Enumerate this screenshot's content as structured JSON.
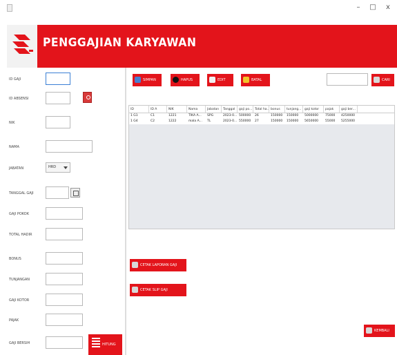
{
  "window": {
    "minimize_glyph": "–",
    "maximize_glyph": "□",
    "close_glyph": "x"
  },
  "banner": {
    "title": "PENGGAJIAN KARYAWAN",
    "logo_icon": "company-logo"
  },
  "form": {
    "labels": {
      "id_gaji": "ID GAJI",
      "id_absensi": "ID ABSENSI",
      "nik": "NIK",
      "nama": "NAMA",
      "jabatan": "JABATAN",
      "tanggal_gaji": "TANGGAL GAJI",
      "gaji_pokok": "GAJI POKOK",
      "total_hadir": "TOTAL HADIR",
      "bonus": "BONUS",
      "tunjangan": "TUNJANGAN",
      "gaji_kotor": "GAJI KOTOR",
      "pajak": "PAJAK",
      "gaji_bersih": "GAJI BERSIH"
    },
    "jabatan_selected": "HRD",
    "hitung_label": "HITUNG"
  },
  "toolbar": {
    "simpan": "SIMPAN",
    "hapus": "HAPUS",
    "edit": "EDIT",
    "batal": "BATAL",
    "cari": "CARI"
  },
  "table": {
    "columns": [
      "ID",
      "ID A",
      "NIK",
      "Nama",
      "Jabatan",
      "Tanggal",
      "gaji po...",
      "Total ha...",
      "bonus",
      "tunjang...",
      "gaji kotor",
      "pajak",
      "gaji ber..."
    ],
    "rows": [
      [
        "1 G1",
        "C1",
        "1221",
        "TIKA A...",
        "SPG",
        "2023-0...",
        "500000",
        "26",
        "150000",
        "150000",
        "5000000",
        "75000",
        "4250000"
      ],
      [
        "1 G4",
        "C2",
        "1222",
        "mala A...",
        "TL",
        "2023-0...",
        "550000",
        "27",
        "150000",
        "150000",
        "5650000",
        "55000",
        "5255000"
      ]
    ]
  },
  "actions": {
    "cetak_laporan": "CETAK LAPORAN GAJI",
    "cetak_slip": "CETAK SLIP GAJI",
    "kembali": "KEMBALI"
  },
  "colors": {
    "brand_red": "#e3141b",
    "focus_blue": "#3a7fd5",
    "table_bg": "#e7e9ed"
  }
}
